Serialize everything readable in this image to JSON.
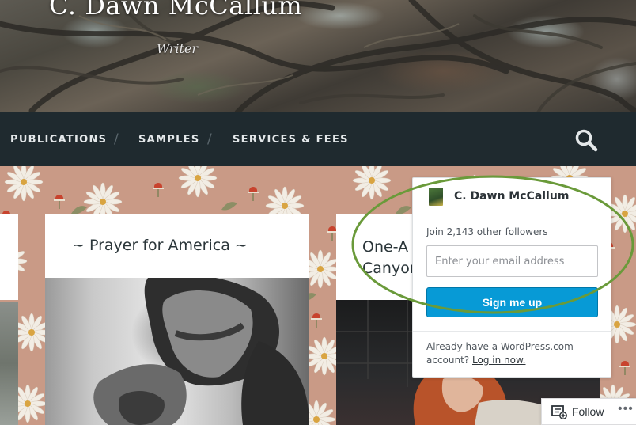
{
  "site": {
    "title": "C. Dawn McCallum",
    "tagline": "Writer"
  },
  "nav": {
    "items": [
      {
        "label": "PUBLICATIONS"
      },
      {
        "label": "SAMPLES"
      },
      {
        "label": "SERVICES & FEES"
      }
    ],
    "separator": "/",
    "search_icon": "search-icon"
  },
  "posts": [
    {
      "title": "~ Prayer for America ~"
    },
    {
      "title_line1": "One-A",
      "title_line2": "Canyon"
    }
  ],
  "follow_popup": {
    "site_name": "C. Dawn McCallum",
    "join_text": "Join 2,143 other followers",
    "email_placeholder": "Enter your email address",
    "signup_label": "Sign me up",
    "already_text": "Already have a WordPress.com account?",
    "login_label": "Log in now."
  },
  "follow_bar": {
    "label": "Follow",
    "more": "•••"
  },
  "colors": {
    "nav_bg": "#1f2a2f",
    "signup_blue": "#079ad6",
    "highlight_green": "#6a9a3a",
    "pattern_bg": "#c99a86"
  }
}
